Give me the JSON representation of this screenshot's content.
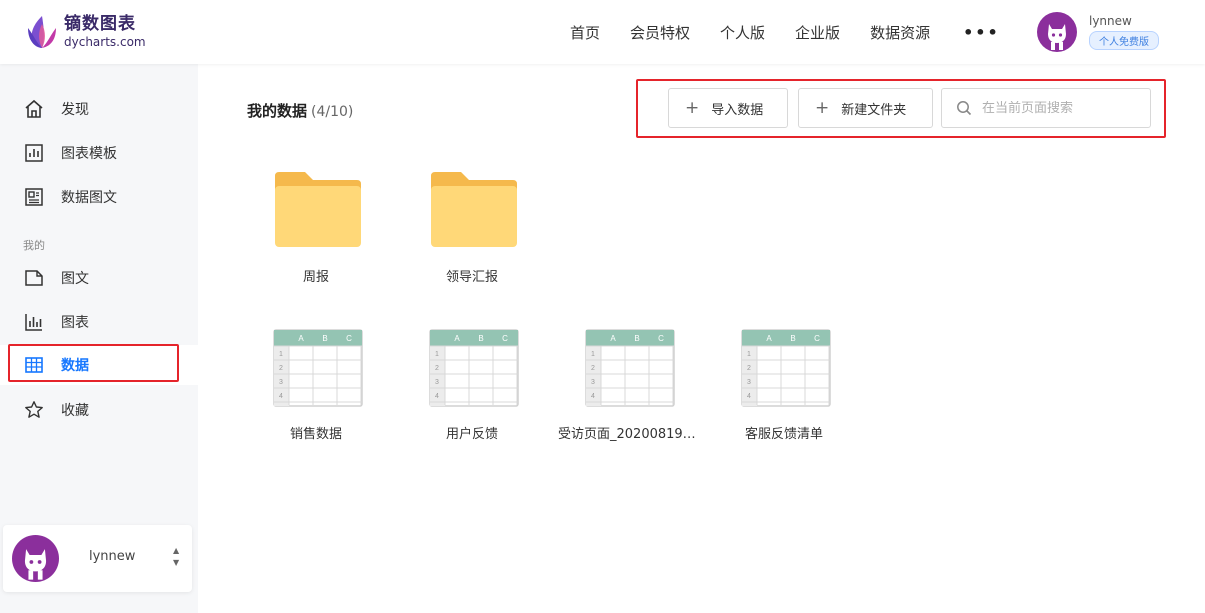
{
  "header": {
    "logo_cn": "镝数图表",
    "logo_en": "dycharts.com",
    "nav": [
      "首页",
      "会员特权",
      "个人版",
      "企业版",
      "数据资源"
    ],
    "more_label": "•••",
    "username": "lynnew",
    "plan": "个人免费版"
  },
  "sidebar": {
    "items_top": [
      {
        "label": "发现",
        "icon": "home-icon"
      },
      {
        "label": "图表模板",
        "icon": "chart-template-icon"
      },
      {
        "label": "数据图文",
        "icon": "data-article-icon"
      }
    ],
    "section_label": "我的",
    "items_mine": [
      {
        "label": "图文",
        "icon": "article-icon"
      },
      {
        "label": "图表",
        "icon": "bar-chart-icon"
      },
      {
        "label": "数据",
        "icon": "table-icon",
        "active": true
      },
      {
        "label": "收藏",
        "icon": "star-icon"
      }
    ],
    "user_name": "lynnew",
    "caret_up": "▲",
    "caret_down": "▼"
  },
  "main": {
    "title": "我的数据",
    "count": "(4/10)",
    "import_button": "导入数据",
    "new_folder_button": "新建文件夹",
    "plus": "+",
    "search_placeholder": "在当前页面搜索",
    "folders": [
      {
        "name": "周报"
      },
      {
        "name": "领导汇报"
      }
    ],
    "files": [
      {
        "name": "销售数据"
      },
      {
        "name": "用户反馈"
      },
      {
        "name": "受访页面_20200819-..."
      },
      {
        "name": "客服反馈清单"
      }
    ],
    "sheet_headers": [
      "A",
      "B",
      "C"
    ],
    "sheet_rows": [
      "1",
      "2",
      "3",
      "4"
    ]
  },
  "colors": {
    "accent": "#1677ff",
    "highlight_red": "#e5242b",
    "folder": "#ffd878",
    "sheet_header": "#94c4b3"
  }
}
